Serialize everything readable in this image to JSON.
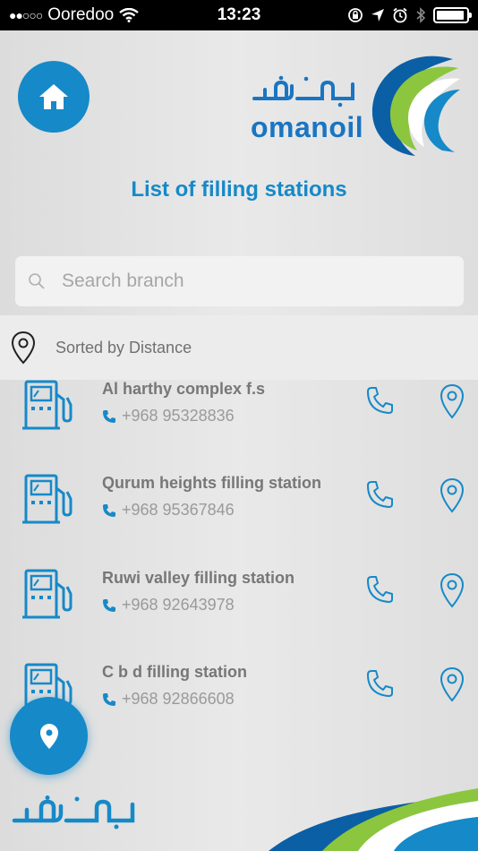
{
  "status_bar": {
    "carrier": "Ooredoo",
    "signal_dots": "●●○○○",
    "time": "13:23",
    "battery_level": 0.95
  },
  "header": {
    "logo_text": "omanoil",
    "logo_arabic": "نفط عمان",
    "title": "List of filling stations"
  },
  "search": {
    "placeholder": "Search branch",
    "value": ""
  },
  "sort": {
    "label": "Sorted by Distance"
  },
  "stations": [
    {
      "name": "Al harthy complex f.s",
      "phone": "+968 95328836"
    },
    {
      "name": "Qurum heights filling station",
      "phone": "+968 95367846"
    },
    {
      "name": "Ruwi valley filling station",
      "phone": "+968 92643978"
    },
    {
      "name": "C b d filling station",
      "phone": "+968 92866608"
    }
  ],
  "footer": {
    "arabic_logo": "نفط عمان"
  },
  "colors": {
    "brand_blue": "#1689c8",
    "logo_green": "#8cc63f",
    "logo_dark_blue": "#0b5fa5"
  },
  "icons": {
    "home": "home-icon",
    "search": "search-icon",
    "sort": "location-pin-icon",
    "station": "fuel-pump-icon",
    "call": "phone-icon",
    "map": "map-pin-icon",
    "fab": "location-pin-icon"
  }
}
